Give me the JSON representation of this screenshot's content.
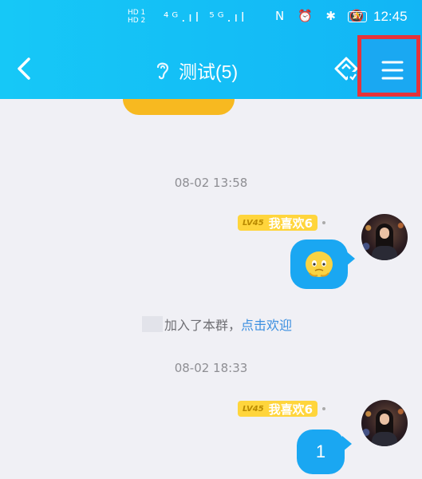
{
  "status_bar": {
    "hd1": "HD 1",
    "hd2": "HD 2",
    "signal": "⁴ᴳ.ıl ⁵ᴳ.ıl",
    "right_icons": "N ⏰ ✱ 🔕",
    "battery": "57",
    "time": "12:45"
  },
  "header": {
    "title": "测试(5)",
    "back_icon": "chevron-left-icon",
    "ear_icon": "ear-icon",
    "diamond_icon": "diamond-icon",
    "menu_icon": "menu-icon"
  },
  "messages": [
    {
      "type": "time",
      "text": "08-02 13:58"
    },
    {
      "type": "message",
      "level": "LV45",
      "name": "我喜欢6",
      "content_kind": "emoji-sticker"
    },
    {
      "type": "system",
      "text": "加入了本群，",
      "link": "点击欢迎"
    },
    {
      "type": "time",
      "text": "08-02 18:33"
    },
    {
      "type": "message",
      "level": "LV45",
      "name": "我喜欢6",
      "content": "1"
    }
  ],
  "colors": {
    "header_blue": "#16c8f7",
    "bubble_blue": "#1aa7f2",
    "highlight_red": "#e5333a",
    "badge_yellow": "#ffd53c",
    "link_blue": "#3b8fe0"
  }
}
